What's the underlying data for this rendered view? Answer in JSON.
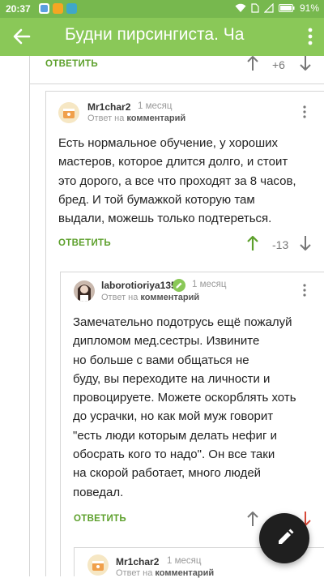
{
  "status_bar": {
    "time": "20:37",
    "battery": "91%"
  },
  "app_bar": {
    "title": "Будни пирсингиста. Ча"
  },
  "comments": [
    {
      "reply_label": "ОТВЕТИТЬ",
      "rating": "+6"
    },
    {
      "author": "Mr1char2",
      "time": "1 месяц",
      "reply_prefix": "Ответ на",
      "reply_target": "комментарий",
      "text": "Есть нормальное обучение, у хороших\nмастеров, которое длится долго, и стоит\nэто дорого, а все что проходят за 8 часов,\nбред. И той бумажкой которую там\nвыдали, можешь только подтереться.",
      "reply_label": "ОТВЕТИТЬ",
      "rating": "-13"
    },
    {
      "author": "laborotioriya135",
      "time": "1 месяц",
      "reply_prefix": "Ответ на",
      "reply_target": "комментарий",
      "text": "Замечательно подотрусь ещё пожалуй\nдипломом мед.сестры. Извините\nно больше с вами общаться не\nбуду, вы переходите на личности и\nпровоцируете. Можете оскорблять хоть\nдо усрачки, но как мой муж говорит\n\"есть люди которым делать нефиг и\nобосрать кого то надо\". Он все таки\nна скорой работает, много людей\nповедал.",
      "reply_label": "ОТВЕТИТЬ"
    },
    {
      "author": "Mr1char2",
      "time": "1 месяц",
      "reply_prefix": "Ответ на",
      "reply_target": "комментарий"
    }
  ],
  "colors": {
    "accent": "#8ac858",
    "link": "#5da02c",
    "fab": "#1f1f1f"
  }
}
